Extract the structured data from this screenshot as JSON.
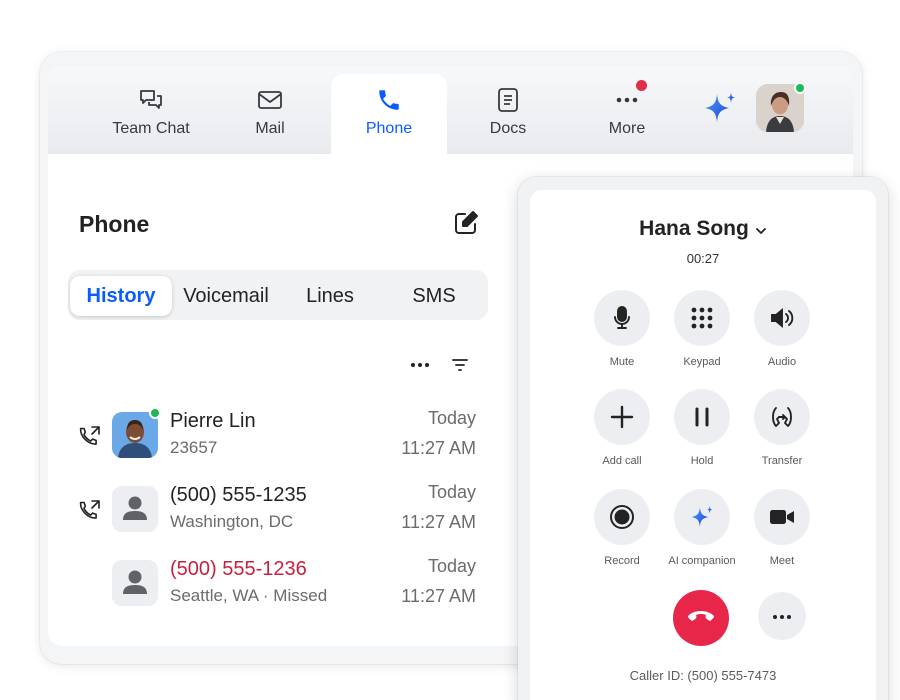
{
  "nav": {
    "tabs": [
      {
        "label": "Team Chat",
        "icon": "chat-bubbles-icon"
      },
      {
        "label": "Mail",
        "icon": "mail-icon"
      },
      {
        "label": "Phone",
        "icon": "phone-icon",
        "active": true
      },
      {
        "label": "Docs",
        "icon": "document-icon"
      },
      {
        "label": "More",
        "icon": "more-dots-icon",
        "notification": true
      }
    ],
    "ai_icon": "sparkle-icon",
    "user_presence": "online"
  },
  "phone": {
    "title": "Phone",
    "segments": [
      "History",
      "Voicemail",
      "Lines",
      "SMS"
    ],
    "active_segment": "History",
    "calls": [
      {
        "name": "Pierre Lin",
        "sub": "23657",
        "day": "Today",
        "time": "11:27 AM",
        "missed": false,
        "has_photo": true,
        "online": true,
        "type_icon": "outgoing-call-icon"
      },
      {
        "name": "(500) 555-1235",
        "sub": "Washington, DC",
        "day": "Today",
        "time": "11:27 AM",
        "missed": false,
        "has_photo": false,
        "type_icon": "outgoing-call-icon"
      },
      {
        "name": "(500) 555-1236",
        "sub": "Seattle, WA · Missed",
        "day": "Today",
        "time": "11:27 AM",
        "missed": true,
        "has_photo": false
      }
    ]
  },
  "call": {
    "caller_name": "Hana Song",
    "timer": "00:27",
    "controls": [
      {
        "label": "Mute",
        "icon": "microphone-icon"
      },
      {
        "label": "Keypad",
        "icon": "keypad-icon"
      },
      {
        "label": "Audio",
        "icon": "speaker-icon"
      },
      {
        "label": "Add call",
        "icon": "plus-icon"
      },
      {
        "label": "Hold",
        "icon": "pause-icon"
      },
      {
        "label": "Transfer",
        "icon": "transfer-icon"
      },
      {
        "label": "Record",
        "icon": "record-icon"
      },
      {
        "label": "AI companion",
        "icon": "sparkle-icon"
      },
      {
        "label": "Meet",
        "icon": "video-camera-icon"
      }
    ],
    "caller_id": "Caller ID: (500) 555-7473"
  },
  "colors": {
    "accent": "#0b5cff",
    "missed": "#c8213f",
    "end_call": "#e8264a",
    "presence": "#1db954",
    "notification": "#e02e4a"
  }
}
